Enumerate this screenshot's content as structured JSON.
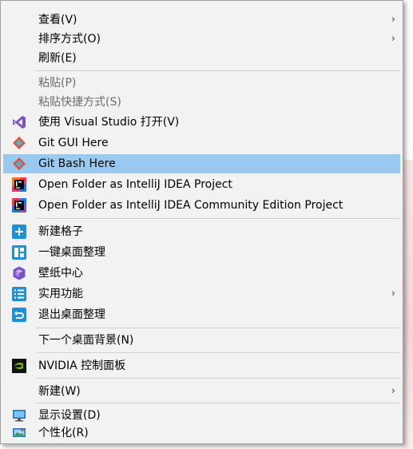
{
  "menu": {
    "view": "查看(V)",
    "sort_by": "排序方式(O)",
    "refresh": "刷新(E)",
    "paste": "粘贴(P)",
    "paste_shortcut": "粘贴快捷方式(S)",
    "open_vs": "使用 Visual Studio 打开(V)",
    "git_gui": "Git GUI Here",
    "git_bash": "Git Bash Here",
    "idea_project": "Open Folder as IntelliJ IDEA Project",
    "idea_ce_project": "Open Folder as IntelliJ IDEA Community Edition Project",
    "new_grid": "新建格子",
    "one_click_organize": "一键桌面整理",
    "wallpaper_center": "壁纸中心",
    "utilities": "实用功能",
    "exit_desktop_organize": "退出桌面整理",
    "next_background": "下一个桌面背景(N)",
    "nvidia_panel": "NVIDIA 控制面板",
    "new": "新建(W)",
    "display_settings": "显示设置(D)",
    "personalize": "个性化(R)"
  },
  "submenu_arrow": "›",
  "colors": {
    "menu_bg": "#f2f2f2",
    "highlight": "#99c9ef",
    "disabled_text": "#6d6d6d",
    "accent_blue": "#1e8fd8"
  },
  "icons": [
    "visual-studio-icon",
    "git-gui-icon",
    "git-bash-icon",
    "intellij-idea-icon",
    "intellij-idea-ce-icon",
    "new-grid-icon",
    "desktop-organize-icon",
    "wallpaper-icon",
    "utilities-icon",
    "exit-organize-icon",
    "nvidia-icon",
    "display-settings-icon",
    "personalize-icon"
  ]
}
